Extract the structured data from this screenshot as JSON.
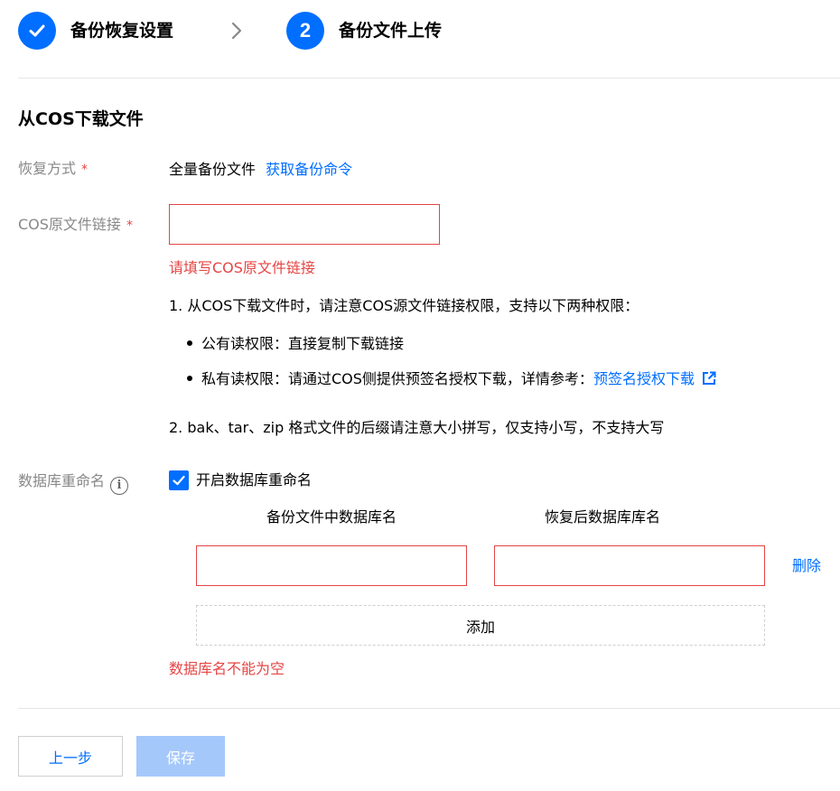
{
  "stepper": {
    "step1": {
      "label": "备份恢复设置",
      "state": "done",
      "icon": "check-icon"
    },
    "separator_icon": "chevron-right-icon",
    "step2": {
      "number": "2",
      "label": "备份文件上传",
      "state": "active"
    }
  },
  "colors": {
    "primary": "#006eff",
    "error": "#e54545",
    "disabled": "#a5c8fb",
    "muted_label": "#888888"
  },
  "section": {
    "title": "从COS下载文件"
  },
  "form": {
    "restore_method": {
      "label": "恢复方式",
      "required_mark": "*",
      "value": "全量备份文件",
      "link": "获取备份命令"
    },
    "cos_link": {
      "label": "COS原文件链接",
      "required_mark": "*",
      "value": "",
      "placeholder": "",
      "error": "请填写COS原文件链接"
    },
    "notes": {
      "line1": "1. 从COS下载文件时，请注意COS源文件链接权限，支持以下两种权限：",
      "bullet1": "公有读权限：直接复制下载链接",
      "bullet2_prefix": "私有读权限：请通过COS侧提供预签名授权下载，详情参考：",
      "bullet2_link": "预签名授权下载",
      "bullet2_link_icon": "external-link-icon",
      "line2": "2. bak、tar、zip 格式文件的后缀请注意大小拼写，仅支持小写，不支持大写"
    },
    "db_rename": {
      "label": "数据库重命名",
      "info_icon": "info-icon",
      "checkbox_label": "开启数据库重命名",
      "checked": true,
      "col_source": "备份文件中数据库名",
      "col_target": "恢复后数据库库名",
      "rows": [
        {
          "source": "",
          "target": "",
          "delete_label": "删除"
        }
      ],
      "add_label": "添加",
      "error": "数据库名不能为空"
    }
  },
  "footer": {
    "prev_label": "上一步",
    "save_label": "保存"
  }
}
